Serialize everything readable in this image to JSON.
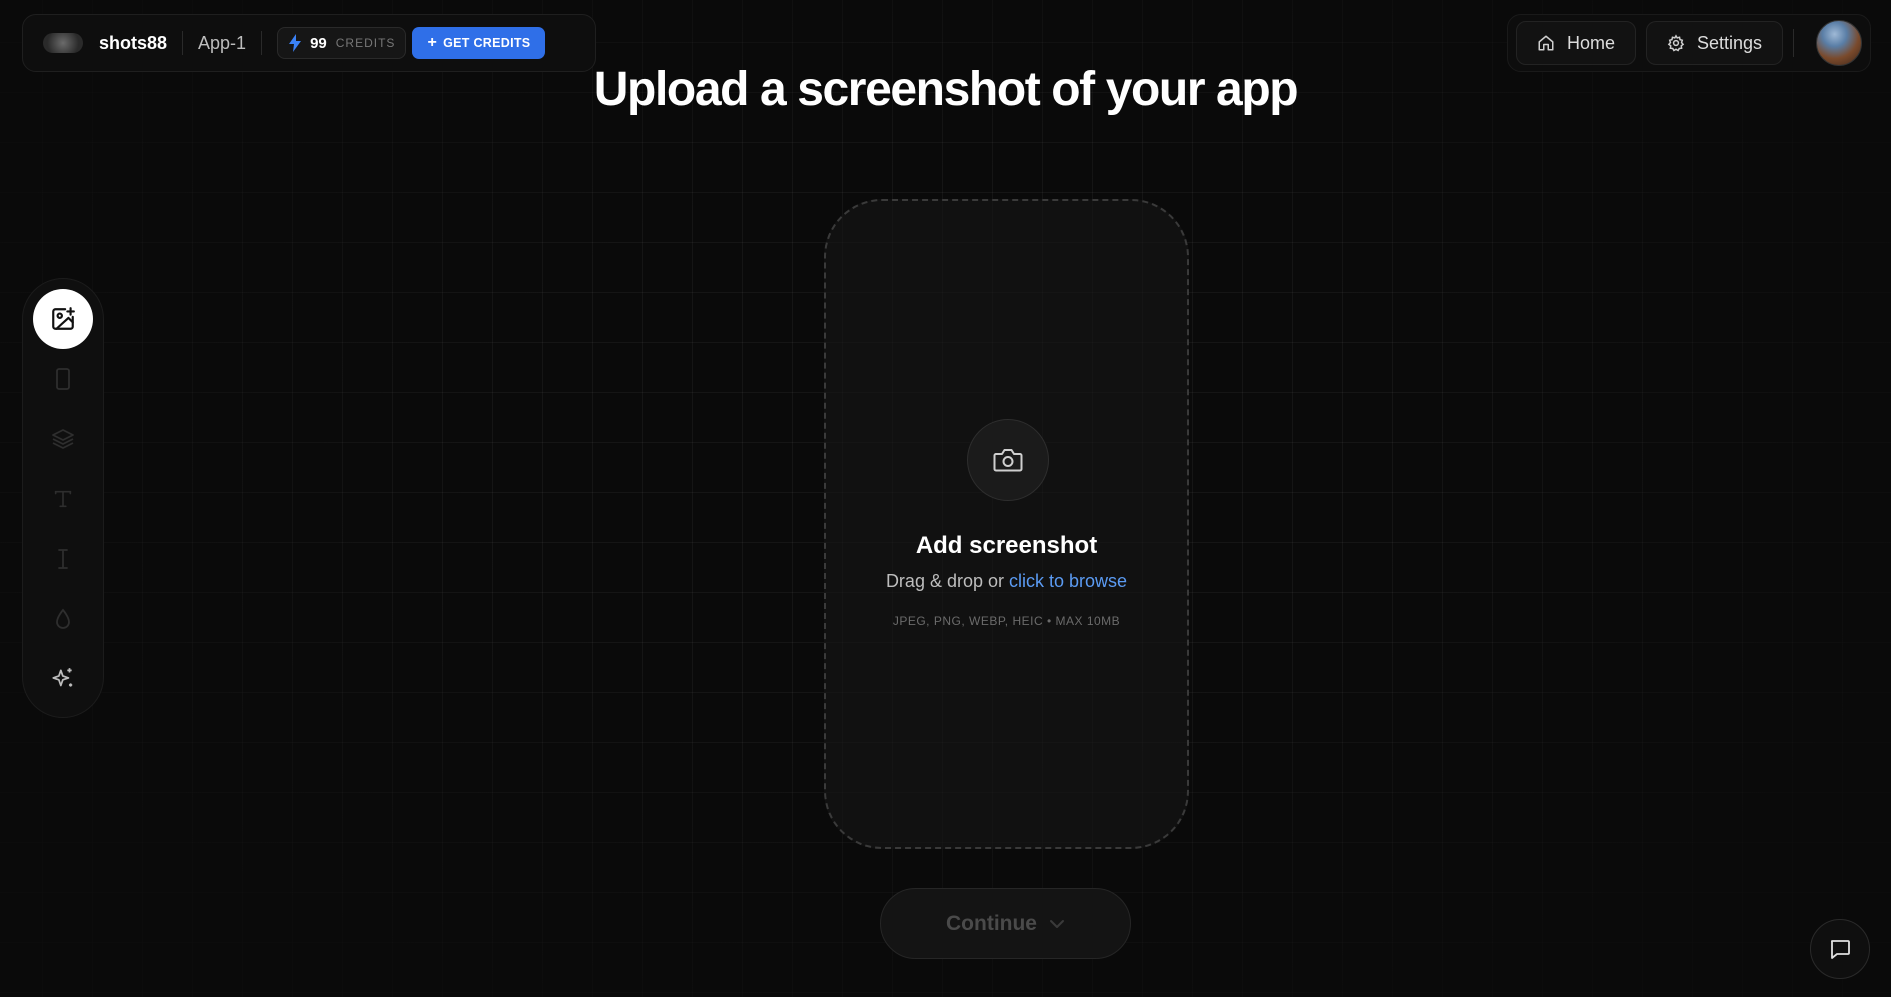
{
  "header": {
    "brand": "shots88",
    "project": "App-1",
    "credits": {
      "count": "99",
      "label": "CREDITS"
    },
    "get_credits_label": "GET CREDITS"
  },
  "nav": {
    "home_label": "Home",
    "settings_label": "Settings"
  },
  "page": {
    "title": "Upload a screenshot of your app"
  },
  "sidebar": {
    "items": [
      {
        "icon": "image-add-icon",
        "active": true
      },
      {
        "icon": "device-icon",
        "active": false
      },
      {
        "icon": "layers-icon",
        "active": false
      },
      {
        "icon": "text-icon",
        "active": false
      },
      {
        "icon": "cursor-text-icon",
        "active": false
      },
      {
        "icon": "droplet-icon",
        "active": false
      },
      {
        "icon": "sparkle-icon",
        "active": false
      }
    ]
  },
  "dropzone": {
    "title": "Add screenshot",
    "prefix": "Drag & drop or ",
    "link": "click to browse",
    "formats": "JPEG, PNG, WEBP, HEIC • MAX 10MB"
  },
  "actions": {
    "continue_label": "Continue"
  },
  "colors": {
    "accent": "#2f6fe8",
    "link": "#5b9bf3",
    "background": "#0a0a0a"
  }
}
